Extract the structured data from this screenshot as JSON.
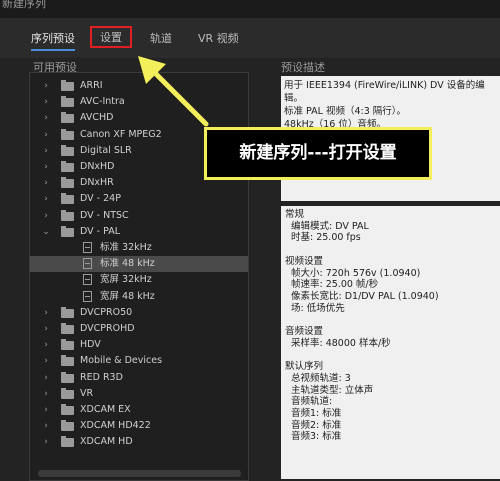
{
  "window": {
    "title": "新建序列"
  },
  "tabs": [
    {
      "label": "序列预设",
      "active": true
    },
    {
      "label": "设置",
      "highlighted": true
    },
    {
      "label": "轨道"
    },
    {
      "label": "VR 视频"
    }
  ],
  "presets_title": "可用预设",
  "description_title": "预设描述",
  "tree": [
    {
      "label": "ARRI",
      "type": "folder",
      "expanded": false
    },
    {
      "label": "AVC-Intra",
      "type": "folder",
      "expanded": false
    },
    {
      "label": "AVCHD",
      "type": "folder",
      "expanded": false
    },
    {
      "label": "Canon XF MPEG2",
      "type": "folder",
      "expanded": false
    },
    {
      "label": "Digital SLR",
      "type": "folder",
      "expanded": false
    },
    {
      "label": "DNxHD",
      "type": "folder",
      "expanded": false
    },
    {
      "label": "DNxHR",
      "type": "folder",
      "expanded": false
    },
    {
      "label": "DV - 24P",
      "type": "folder",
      "expanded": false
    },
    {
      "label": "DV - NTSC",
      "type": "folder",
      "expanded": false
    },
    {
      "label": "DV - PAL",
      "type": "folder",
      "expanded": true
    },
    {
      "label": "标准 32kHz",
      "type": "preset"
    },
    {
      "label": "标准 48 kHz",
      "type": "preset",
      "selected": true
    },
    {
      "label": "宽屏 32kHz",
      "type": "preset"
    },
    {
      "label": "宽屏 48 kHz",
      "type": "preset"
    },
    {
      "label": "DVCPRO50",
      "type": "folder",
      "expanded": false
    },
    {
      "label": "DVCPROHD",
      "type": "folder",
      "expanded": false
    },
    {
      "label": "HDV",
      "type": "folder",
      "expanded": false
    },
    {
      "label": "Mobile & Devices",
      "type": "folder",
      "expanded": false
    },
    {
      "label": "RED R3D",
      "type": "folder",
      "expanded": false
    },
    {
      "label": "VR",
      "type": "folder",
      "expanded": false
    },
    {
      "label": "XDCAM EX",
      "type": "folder",
      "expanded": false
    },
    {
      "label": "XDCAM HD422",
      "type": "folder",
      "expanded": false
    },
    {
      "label": "XDCAM HD",
      "type": "folder",
      "expanded": false
    }
  ],
  "description": {
    "line1": "用于 IEEE1394 (FireWire/iLINK) DV 设备的编辑。",
    "line2": "标准 PAL 视频（4:3 隔行）。",
    "line3": "48kHz（16 位）音频。"
  },
  "details": {
    "general_heading": "常规",
    "edit_mode": "编辑模式: DV PAL",
    "timebase": "时基: 25.00 fps",
    "video_heading": "视频设置",
    "frame_size": "帧大小: 720h 576v (1.0940)",
    "frame_rate": "帧速率: 25.00 帧/秒",
    "pixel_aspect": "像素长宽比: D1/DV PAL (1.0940)",
    "fields": "场: 低场优先",
    "audio_heading": "音频设置",
    "sample_rate": "采样率: 48000 样本/秒",
    "seq_heading": "默认序列",
    "total_tracks": "总视频轨道: 3",
    "master_track": "主轨道类型: 立体声",
    "audio_tracks": "音频轨道:",
    "track1": "音频1: 标准",
    "track2": "音频2: 标准",
    "track3": "音频3: 标准"
  },
  "annotation": {
    "text": "新建序列---打开设置",
    "color": "#f3ef5a"
  },
  "colors": {
    "accent": "#4a8ed8",
    "highlight_box": "#e02020",
    "arrow": "#f3ef5a"
  }
}
